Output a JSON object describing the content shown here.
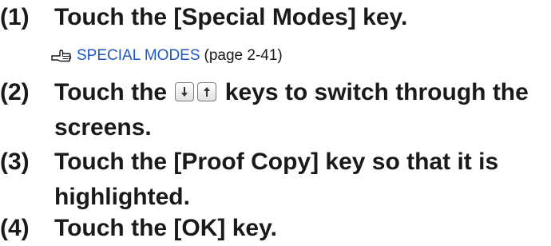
{
  "steps": [
    {
      "number": "(1)",
      "text": "Touch the [Special Modes] key."
    },
    {
      "number": "(2)",
      "text_before": "Touch the",
      "text_after": "keys to switch through the screens."
    },
    {
      "number": "(3)",
      "text": "Touch the [Proof Copy] key so that it is highlighted."
    },
    {
      "number": "(4)",
      "text": "Touch the [OK] key."
    }
  ],
  "reference": {
    "icon": "pointing-hand-icon",
    "link_text": "SPECIAL MODES",
    "page": "(page 2-41)"
  },
  "colors": {
    "link": "#1e57c7",
    "text": "#1a1a1a"
  }
}
